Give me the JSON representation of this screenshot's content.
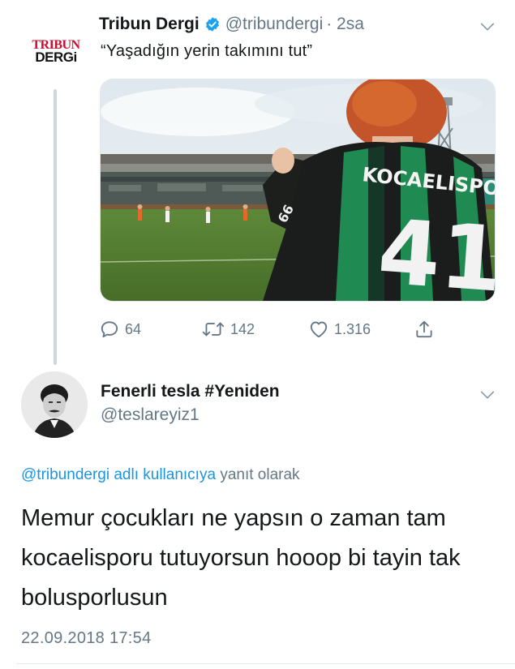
{
  "tweet": {
    "avatar_logo_top": "TRIBUN",
    "avatar_logo_bottom": "DERGi",
    "author_name": "Tribun Dergi",
    "author_handle": "@tribundergi",
    "time_ago": "· 2sa",
    "text": "“Yaşadığın yerin takımını tut”",
    "image_jersey_text": "KOCAELISPOR",
    "image_jersey_number": "41",
    "image_sleeve_text": "66",
    "reply_count": "64",
    "retweet_count": "142",
    "like_count": "1.316"
  },
  "reply": {
    "author_name": "Fenerli tesla #Yeniden",
    "author_handle": "@teslareyiz1",
    "replying_to_handle": "@tribundergi adlı kullanıcıya",
    "replying_suffix": "yanıt olarak",
    "text": "Memur çocukları ne yapsın o zaman tam kocaelisporu tutuyorsun hooop bi tayin tak bolusporlusun",
    "timestamp": "22.09.2018 17:54"
  },
  "colors": {
    "accent": "#1da1f2",
    "link": "#1b95e0",
    "secondary_text": "#657786",
    "divider": "#e1e8ed",
    "thread_line": "#ccd6dd"
  },
  "icons": [
    "verified-badge-icon",
    "chevron-down-icon",
    "reply-icon",
    "retweet-icon",
    "like-icon",
    "share-icon"
  ]
}
